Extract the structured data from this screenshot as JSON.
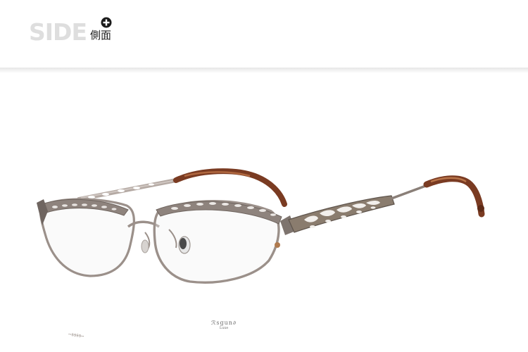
{
  "header": {
    "title": "SIDE",
    "subtitle": "側面",
    "icon": "plus-circle-icon",
    "title_color": "#dedede",
    "subtitle_color": "#1e1e1e"
  },
  "photo": {
    "subject": "eyeglasses-side-view",
    "frame_color": "#9c8f89",
    "temple_tip_color": "#7a3b22",
    "lens_logo": {
      "brand": "ℛsgun∂",
      "sub": "Luxe"
    },
    "temple_inscription": "ꟷꞨꞨꞨꞨꟷ"
  }
}
